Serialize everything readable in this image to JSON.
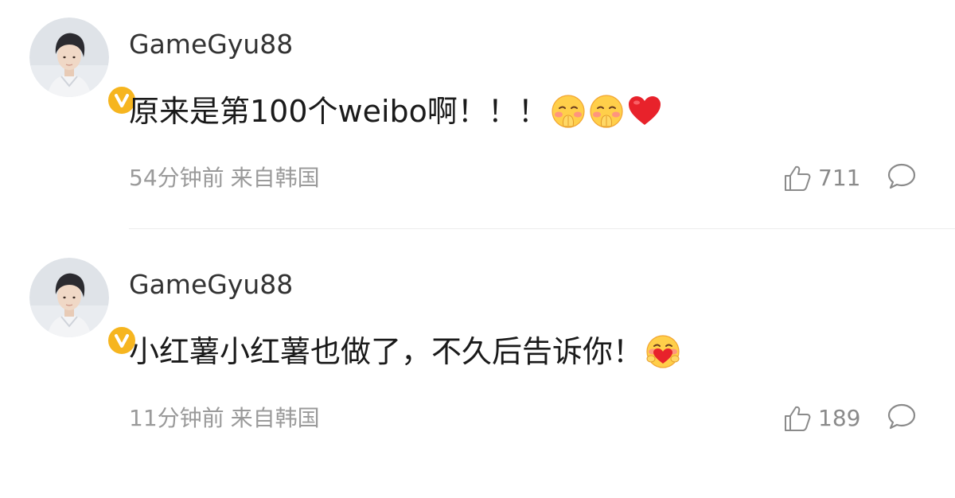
{
  "comments": [
    {
      "username": "GameGyu88",
      "verified": true,
      "text": "原来是第100个weibo啊！！！",
      "emojis": [
        "shy-covering-mouth-emoji",
        "shy-covering-mouth-emoji",
        "red-heart-emoji"
      ],
      "time": "54分钟前",
      "location": "来自韩国",
      "likes": "711"
    },
    {
      "username": "GameGyu88",
      "verified": true,
      "text": "小红薯小红薯也做了，不久后告诉你！",
      "emojis": [
        "hugging-heart-emoji"
      ],
      "time": "11分钟前",
      "location": "来自韩国",
      "likes": "189"
    }
  ],
  "colors": {
    "verified_badge": "#f6b51f",
    "meta_text": "#9a9a9a",
    "heart": "#e8222b"
  }
}
